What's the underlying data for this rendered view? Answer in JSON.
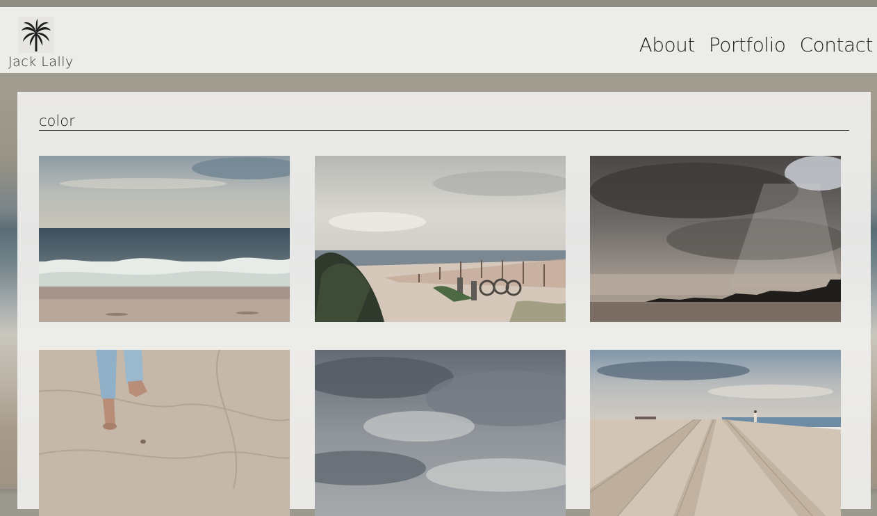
{
  "site": {
    "name": "Jack Lally",
    "logo_icon": "palm-tree-icon"
  },
  "nav": {
    "items": [
      {
        "label": "About"
      },
      {
        "label": "Portfolio"
      },
      {
        "label": "Contact"
      }
    ]
  },
  "gallery": {
    "title": "color",
    "photos": [
      {
        "subject": "ocean-waves-photo"
      },
      {
        "subject": "beach-bicycles-fence-photo"
      },
      {
        "subject": "storm-clouds-shoreline-photo"
      },
      {
        "subject": "barefoot-walker-sand-photo"
      },
      {
        "subject": "overcast-clouds-photo"
      },
      {
        "subject": "beach-tire-tracks-photo"
      }
    ]
  },
  "colors": {
    "header_bg": "#f0f0ee",
    "panel_bg": "#eeeeec",
    "text": "#1c1c1c"
  }
}
